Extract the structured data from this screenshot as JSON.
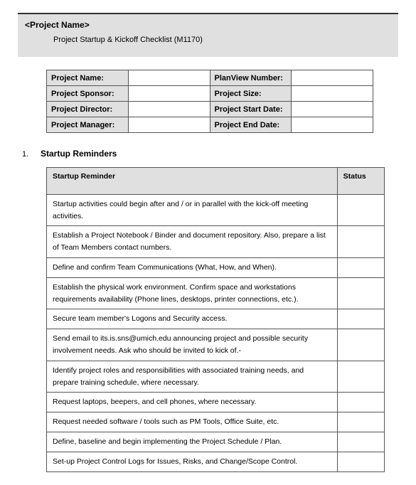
{
  "header": {
    "title": "<Project Name>",
    "subtitle": "Project Startup & Kickoff Checklist (M1170)"
  },
  "info_table": {
    "rows": [
      {
        "left_label": "Project Name:",
        "left_value": "",
        "right_label": "PlanView Number:",
        "right_value": ""
      },
      {
        "left_label": "Project Sponsor:",
        "left_value": "",
        "right_label": "Project Size:",
        "right_value": ""
      },
      {
        "left_label": "Project Director:",
        "left_value": "",
        "right_label": "Project Start Date:",
        "right_value": ""
      },
      {
        "left_label": "Project Manager:",
        "left_value": "",
        "right_label": "Project End Date:",
        "right_value": ""
      }
    ]
  },
  "section": {
    "number": "1.",
    "title": "Startup Reminders"
  },
  "reminder_table": {
    "headers": {
      "reminder": "Startup Reminder",
      "status": "Status"
    },
    "rows": [
      {
        "text": "Startup activities could begin after and / or in parallel with the kick-off meeting activities.",
        "status": ""
      },
      {
        "text": "Establish a Project Notebook / Binder and document repository. Also, prepare a list of Team Members contact numbers.",
        "status": ""
      },
      {
        "text": "Define and confirm Team Communications (What, How, and When).",
        "status": ""
      },
      {
        "text": "Establish the physical work environment. Confirm space and workstations requirements availability (Phone lines, desktops, printer connections, etc.).",
        "status": ""
      },
      {
        "text": "Secure team member's Logons and Security access.",
        "status": ""
      },
      {
        "text": "Send email to its.is.sns@umich.edu announcing project and possible security involvement needs.  Ask who should be invited to kick of.-",
        "status": ""
      },
      {
        "text": "Identify project roles and responsibilities with associated training needs, and prepare training schedule, where necessary.",
        "status": ""
      },
      {
        "text": "Request laptops, beepers, and cell phones, where necessary.",
        "status": ""
      },
      {
        "text": "Request needed software / tools such as PM Tools, Office Suite, etc.",
        "status": ""
      },
      {
        "text": "Define, baseline and begin implementing the Project Schedule / Plan.",
        "status": ""
      },
      {
        "text": "Set-up Project Control Logs for Issues, Risks, and Change/Scope Control.",
        "status": ""
      }
    ]
  }
}
